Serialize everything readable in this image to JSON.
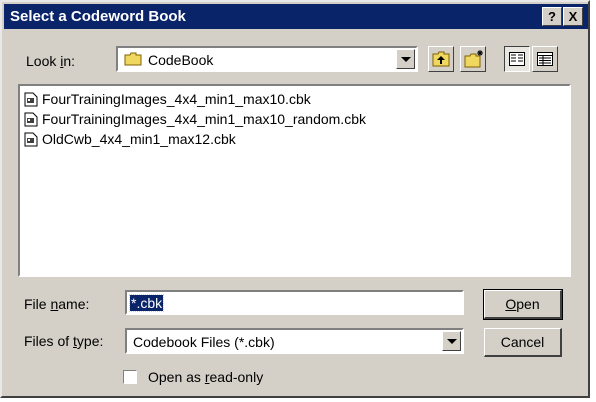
{
  "window": {
    "title": "Select a Codeword Book",
    "help_label": "?",
    "close_label": "X"
  },
  "look_in": {
    "label_pre": "Look ",
    "label_key": "i",
    "label_post": "n:",
    "value": "CodeBook"
  },
  "files": [
    {
      "name": "FourTrainingImages_4x4_min1_max10.cbk"
    },
    {
      "name": "FourTrainingImages_4x4_min1_max10_random.cbk"
    },
    {
      "name": "OldCwb_4x4_min1_max12.cbk"
    }
  ],
  "file_name": {
    "label_pre": "File ",
    "label_key": "n",
    "label_post": "ame:",
    "value": "*.cbk"
  },
  "file_type": {
    "label_pre": "Files of ",
    "label_key": "t",
    "label_post": "ype:",
    "value": "Codebook Files (*.cbk)"
  },
  "read_only": {
    "label_pre": "Open as ",
    "label_key": "r",
    "label_post": "ead-only",
    "checked": false
  },
  "buttons": {
    "open_key": "O",
    "open_rest": "pen",
    "cancel": "Cancel"
  },
  "colors": {
    "title_bar": "#0a246a",
    "face": "#d4d0c8",
    "selection": "#0a246a"
  }
}
